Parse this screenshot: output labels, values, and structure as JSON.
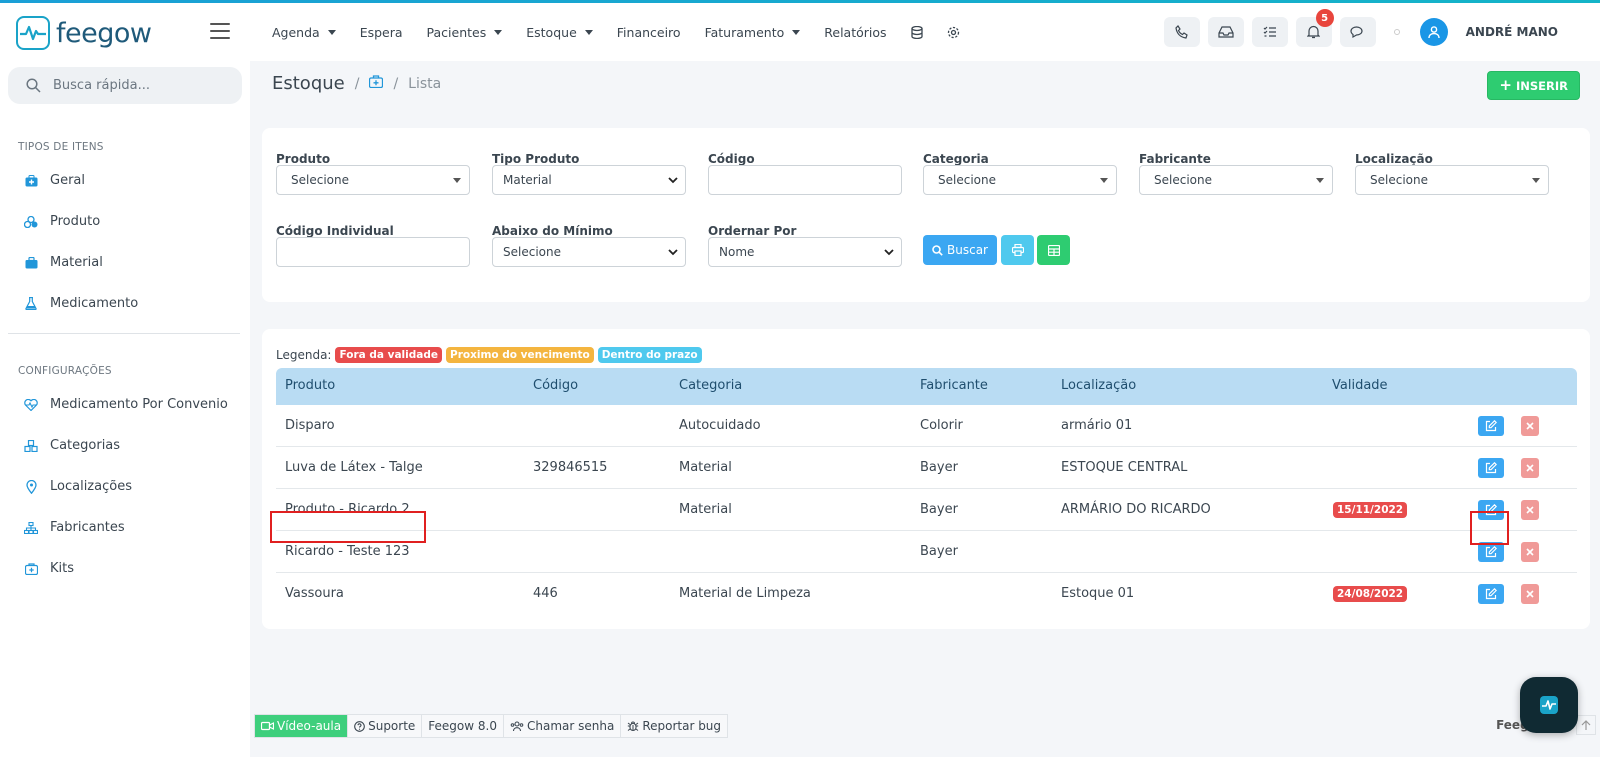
{
  "app": {
    "logo_text": "feegow",
    "colors": {
      "accent": "#1a96e6",
      "success": "#2ecc71",
      "danger": "#e84c4c",
      "warning": "#f4b53f",
      "info": "#4fc9ee"
    }
  },
  "nav": {
    "items": [
      {
        "label": "Agenda",
        "dropdown": true
      },
      {
        "label": "Espera",
        "dropdown": false
      },
      {
        "label": "Pacientes",
        "dropdown": true
      },
      {
        "label": "Estoque",
        "dropdown": true
      },
      {
        "label": "Financeiro",
        "dropdown": false
      },
      {
        "label": "Faturamento",
        "dropdown": true
      },
      {
        "label": "Relatórios",
        "dropdown": false
      }
    ],
    "notifications_count": "5",
    "user_name": "ANDRÉ MANO"
  },
  "sidebar": {
    "search_placeholder": "Busca rápida...",
    "section1_title": "TIPOS DE ITENS",
    "section1_items": [
      "Geral",
      "Produto",
      "Material",
      "Medicamento"
    ],
    "section2_title": "CONFIGURAÇÕES",
    "section2_items": [
      "Medicamento Por Convenio",
      "Categorias",
      "Localizações",
      "Fabricantes",
      "Kits"
    ]
  },
  "breadcrumb": {
    "title": "Estoque",
    "separator": "/",
    "current": "Lista"
  },
  "insert_label": "INSERIR",
  "filters": {
    "produto": {
      "label": "Produto",
      "value": "Selecione"
    },
    "tipo_produto": {
      "label": "Tipo Produto",
      "value": "Material"
    },
    "codigo": {
      "label": "Código",
      "value": ""
    },
    "categoria": {
      "label": "Categoria",
      "value": "Selecione"
    },
    "fabricante": {
      "label": "Fabricante",
      "value": "Selecione"
    },
    "localizacao": {
      "label": "Localização",
      "value": "Selecione"
    },
    "codigo_individual": {
      "label": "Código Individual",
      "value": ""
    },
    "abaixo_minimo": {
      "label": "Abaixo do Mínimo",
      "value": "Selecione"
    },
    "ordenar_por": {
      "label": "Ordernar Por",
      "value": "Nome"
    },
    "search_button": "Buscar"
  },
  "legend": {
    "label": "Legenda:",
    "expired": "Fora da validade",
    "near": "Proximo do vencimento",
    "valid": "Dentro do prazo"
  },
  "table": {
    "headers": [
      "Produto",
      "Código",
      "Categoria",
      "Fabricante",
      "Localização",
      "Validade"
    ],
    "rows": [
      {
        "produto": "Disparo",
        "codigo": "",
        "categoria": "Autocuidado",
        "fabricante": "Colorir",
        "localizacao": "armário 01",
        "validade": ""
      },
      {
        "produto": "Luva de Látex - Talge",
        "codigo": "329846515",
        "categoria": "Material",
        "fabricante": "Bayer",
        "localizacao": "ESTOQUE CENTRAL",
        "validade": ""
      },
      {
        "produto": "Produto - Ricardo 2",
        "codigo": "",
        "categoria": "Material",
        "fabricante": "Bayer",
        "localizacao": "ARMÁRIO DO RICARDO",
        "validade": "15/11/2022"
      },
      {
        "produto": "Ricardo - Teste 123",
        "codigo": "",
        "categoria": "",
        "fabricante": "Bayer",
        "localizacao": "",
        "validade": ""
      },
      {
        "produto": "Vassoura",
        "codigo": "446",
        "categoria": "Material de Limpeza",
        "fabricante": "",
        "localizacao": "Estoque 01",
        "validade": "24/08/2022"
      }
    ]
  },
  "footer": {
    "video": "Vídeo-aula",
    "support": "Suporte",
    "version": "Feegow 8.0",
    "call": "Chamar senha",
    "bug": "Reportar bug",
    "brand": "Feegow"
  }
}
